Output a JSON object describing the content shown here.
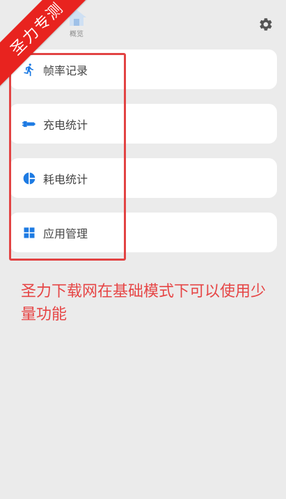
{
  "nav": {
    "overview_label": "概览"
  },
  "ribbon": {
    "text": "圣力专测"
  },
  "menu": {
    "items": [
      {
        "label": "帧率记录",
        "icon": "running-person-icon"
      },
      {
        "label": "充电统计",
        "icon": "charger-plug-icon"
      },
      {
        "label": "耗电统计",
        "icon": "pie-chart-icon"
      },
      {
        "label": "应用管理",
        "icon": "app-grid-icon"
      }
    ]
  },
  "notice": {
    "text": "圣力下载网在基础模式下可以使用少量功能"
  },
  "colors": {
    "accent": "#1e7be3",
    "highlight": "#e24343",
    "notice": "#e64545",
    "background": "#ebebeb"
  }
}
